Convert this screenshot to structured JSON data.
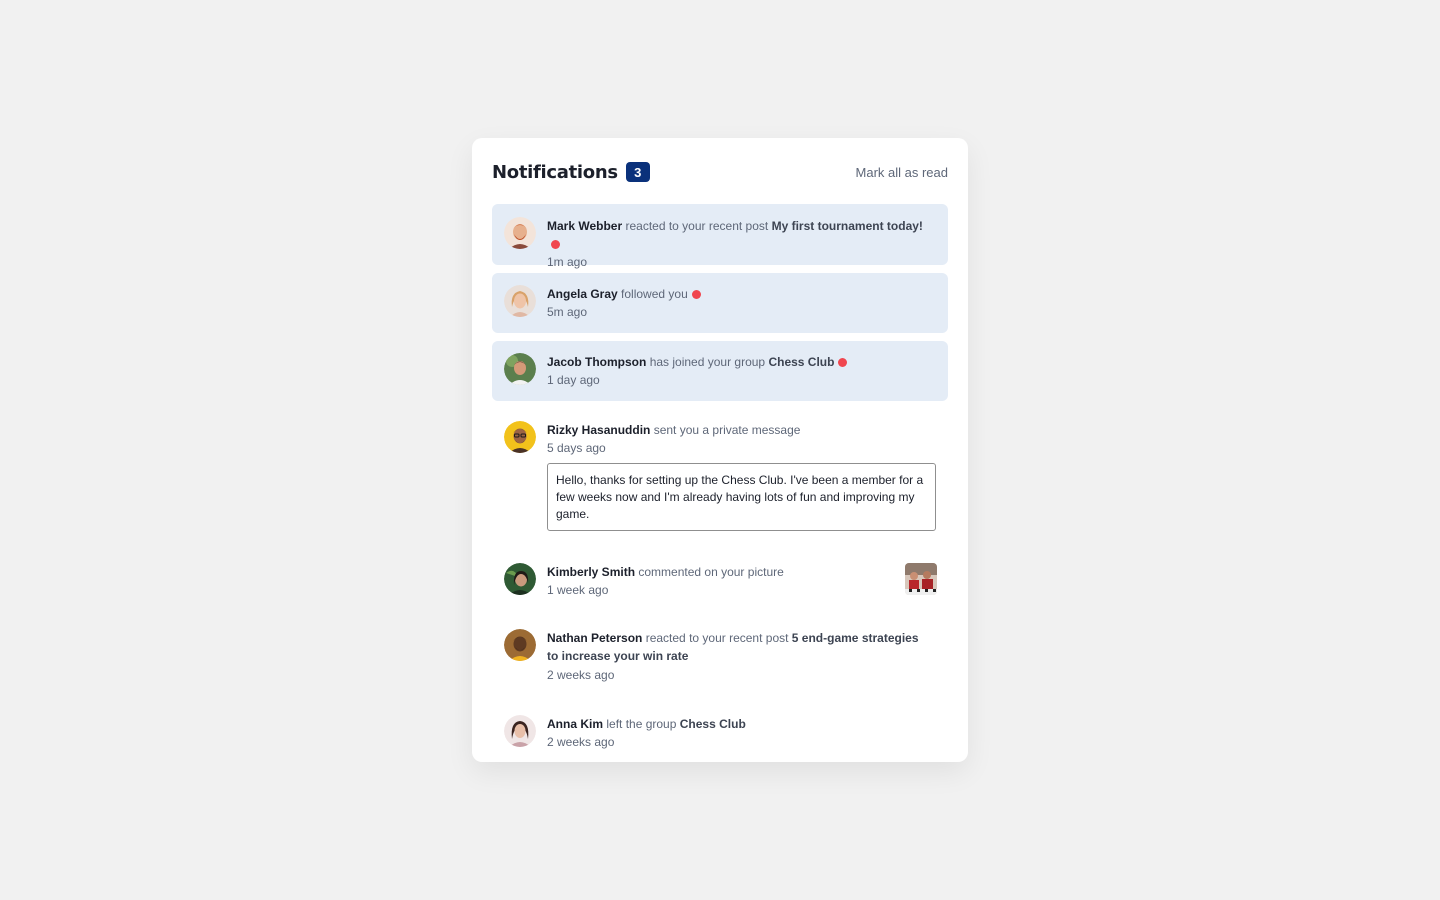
{
  "header": {
    "title": "Notifications",
    "unread_count": "3",
    "mark_all_label": "Mark all as read"
  },
  "notifications": [
    {
      "name": "Mark Webber",
      "action": "reacted to your recent post",
      "target": "My first tournament today!",
      "time": "1m ago",
      "unread": true
    },
    {
      "name": "Angela Gray",
      "action": "followed you",
      "target": "",
      "time": "5m ago",
      "unread": true
    },
    {
      "name": "Jacob Thompson",
      "action": "has joined your group",
      "target": "Chess Club",
      "time": "1 day ago",
      "unread": true
    },
    {
      "name": "Rizky Hasanuddin",
      "action": "sent you a private message",
      "target": "",
      "time": "5 days ago",
      "unread": false,
      "message": "Hello, thanks for setting up the Chess Club. I've been a member for a few weeks now and I'm already having lots of fun and improving my game."
    },
    {
      "name": "Kimberly Smith",
      "action": "commented on your picture",
      "target": "",
      "time": "1 week ago",
      "unread": false
    },
    {
      "name": "Nathan Peterson",
      "action": "reacted to your recent post",
      "target": "5 end-game strategies to increase your win rate",
      "time": "2 weeks ago",
      "unread": false
    },
    {
      "name": "Anna Kim",
      "action": "left the group",
      "target": "Chess Club",
      "time": "2 weeks ago",
      "unread": false
    }
  ],
  "colors": {
    "background": "#f1f1f1",
    "card": "#ffffff",
    "unread_bg": "#e4ecf6",
    "badge": "#0a317b",
    "dot": "#f0464f",
    "text_dark": "#1c202b",
    "text_muted": "#5e6778"
  },
  "icons": {
    "unread_indicator": "red-dot-icon",
    "avatar": "avatar-photo",
    "comment_picture": "chess-picture-thumbnail"
  }
}
